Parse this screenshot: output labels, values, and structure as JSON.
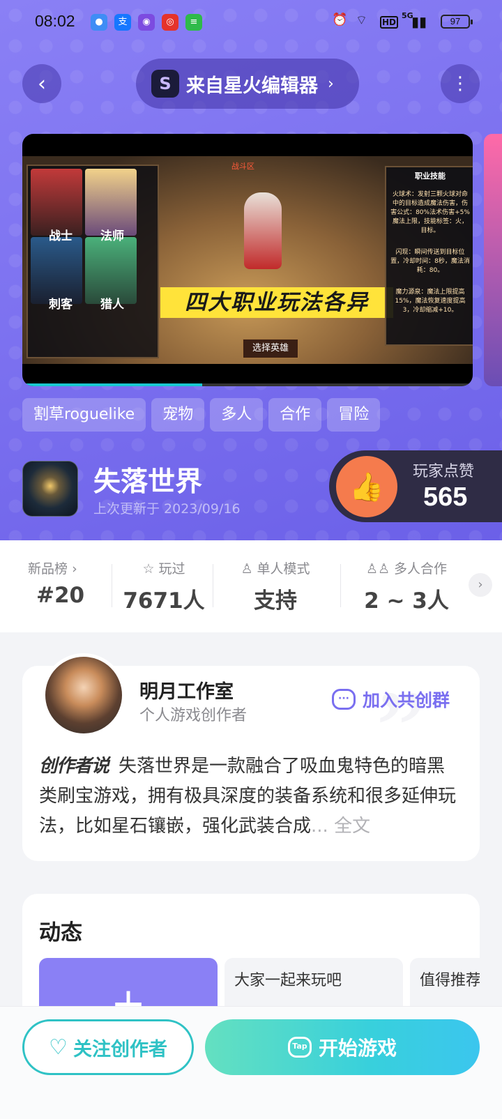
{
  "status_bar": {
    "time": "08:02",
    "battery": "97",
    "signal_label": "5G",
    "hd_label": "HD",
    "notification_icons": [
      "message-icon",
      "alipay-icon",
      "chat-icon",
      "app-icon",
      "music-icon"
    ]
  },
  "header": {
    "source_label": "来自星火编辑器",
    "back_icon": "back-icon",
    "more_icon": "more-icon"
  },
  "screenshot": {
    "chars": [
      "战士",
      "法师",
      "刺客",
      "猎人"
    ],
    "skill_title": "职业技能",
    "skill_lines": [
      "火球术：发射三颗火球对命中的目标造成魔法伤害，伤害公式：80%法术伤害+5%魔法上限，技能标签：火，目标。",
      "闪现：瞬间传送到目标位置，冷却时间：8秒，魔法消耗：80。",
      "魔力源泉：魔法上限提高15%，魔法恢复速度提高3，冷却缩减+10。"
    ],
    "promo_text": "四大职业玩法各异",
    "select_label": "选择英雄",
    "hero_name": "战斗区",
    "progress": 0.4
  },
  "tags": [
    "割草roguelike",
    "宠物",
    "多人",
    "合作",
    "冒险"
  ],
  "game": {
    "name": "失落世界",
    "updated": "上次更新于 2023/09/16"
  },
  "likes": {
    "label": "玩家点赞",
    "count": "565"
  },
  "stats": [
    {
      "label": "新品榜",
      "value": "#20"
    },
    {
      "label": "玩过",
      "value": "7671人"
    },
    {
      "label": "单人模式",
      "value": "支持"
    },
    {
      "label": "多人合作",
      "value": "2 ~ 3人"
    }
  ],
  "creator": {
    "name": "明月工作室",
    "role": "个人游戏创作者",
    "join_label": "加入共创群",
    "intro_label": "创作者说",
    "intro_text": "失落世界是一款融合了吸血鬼特色的暗黑类刷宝游戏，拥有极具深度的装备系统和很多延伸玩法，比如星石镶嵌，强化武装合成",
    "more_label": "... 全文"
  },
  "feed": {
    "title": "动态",
    "posts": [
      "大家一起来玩吧",
      "值得推荐"
    ]
  },
  "bottom": {
    "follow_label": "关注创作者",
    "play_label": "开始游戏",
    "play_icon_text": "Tap"
  },
  "colors": {
    "hero_purple": "#7d72f0",
    "accent_teal": "#2fc2c5",
    "like_orange": "#f57b4d",
    "link_purple": "#7a6ff0"
  }
}
